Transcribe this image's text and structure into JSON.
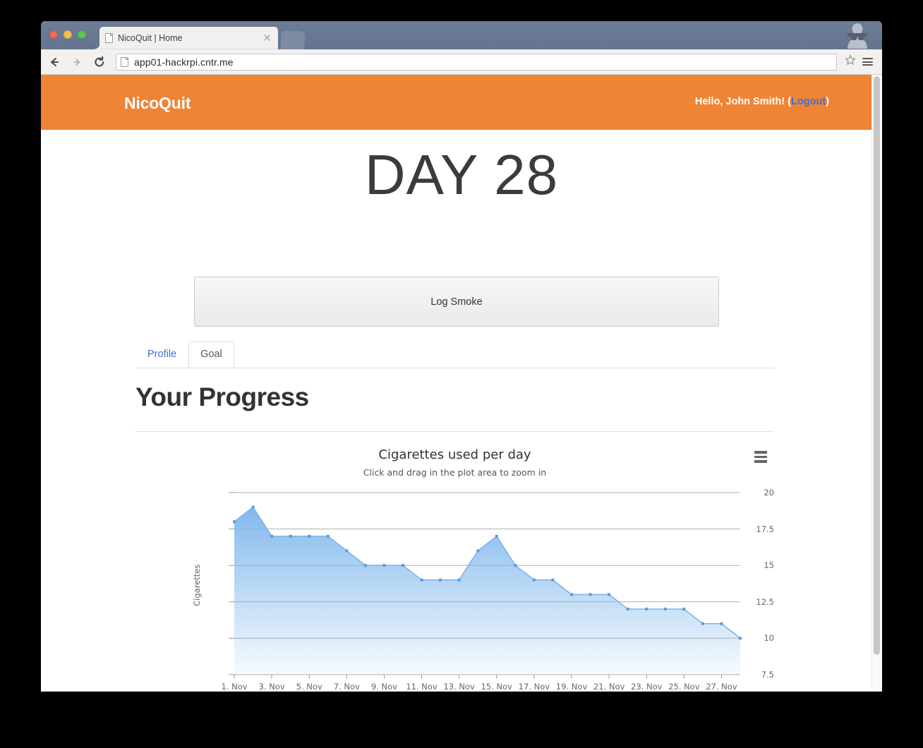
{
  "browser": {
    "tab_title": "NicoQuit | Home",
    "url": "app01-hackrpi.cntr.me",
    "back_icon": "back-arrow-icon",
    "forward_icon": "forward-arrow-icon",
    "reload_icon": "reload-icon",
    "star_icon": "bookmark-star-icon",
    "menu_icon": "hamburger-menu-icon",
    "profile_icon": "incognito-icon",
    "new_tab_icon": "new-tab-icon",
    "close_tab_icon": "close-icon"
  },
  "navbar": {
    "brand": "NicoQuit",
    "greeting_prefix": "Hello, John Smith! (",
    "logout_label": "Logout",
    "greeting_suffix": ")",
    "background_color": "#ef8434"
  },
  "page": {
    "day_title": "DAY 28",
    "log_button": "Log Smoke",
    "tabs": [
      {
        "label": "Profile",
        "active": false
      },
      {
        "label": "Goal",
        "active": true
      }
    ],
    "section_heading": "Your Progress"
  },
  "chart_data": {
    "type": "area",
    "title": "Cigarettes used per day",
    "subtitle": "Click and drag in the plot area to zoom in",
    "xlabel": "",
    "ylabel": "Cigarettes",
    "ylim": [
      7.5,
      20
    ],
    "yticks": [
      7.5,
      10,
      12.5,
      15,
      17.5,
      20
    ],
    "ytick_labels": [
      "7.5",
      "10",
      "12.5",
      "15",
      "17.5",
      "20"
    ],
    "xticks": [
      "1. Nov",
      "3. Nov",
      "5. Nov",
      "7. Nov",
      "9. Nov",
      "11. Nov",
      "13. Nov",
      "15. Nov",
      "17. Nov",
      "19. Nov",
      "21. Nov",
      "23. Nov",
      "25. Nov",
      "27. Nov"
    ],
    "grid": true,
    "legend": false,
    "menu_icon": "chart-context-menu-icon",
    "series": [
      {
        "name": "Cigarettes",
        "color": "#7cb5ec",
        "categories": [
          "1. Nov",
          "2. Nov",
          "3. Nov",
          "4. Nov",
          "5. Nov",
          "6. Nov",
          "7. Nov",
          "8. Nov",
          "9. Nov",
          "10. Nov",
          "11. Nov",
          "12. Nov",
          "13. Nov",
          "14. Nov",
          "15. Nov",
          "16. Nov",
          "17. Nov",
          "18. Nov",
          "19. Nov",
          "20. Nov",
          "21. Nov",
          "22. Nov",
          "23. Nov",
          "24. Nov",
          "25. Nov",
          "26. Nov",
          "27. Nov",
          "28. Nov"
        ],
        "values": [
          18,
          19,
          17,
          17,
          17,
          17,
          16,
          15,
          15,
          15,
          14,
          14,
          14,
          16,
          17,
          15,
          14,
          14,
          13,
          13,
          13,
          12,
          12,
          12,
          12,
          11,
          11,
          10
        ]
      }
    ]
  }
}
